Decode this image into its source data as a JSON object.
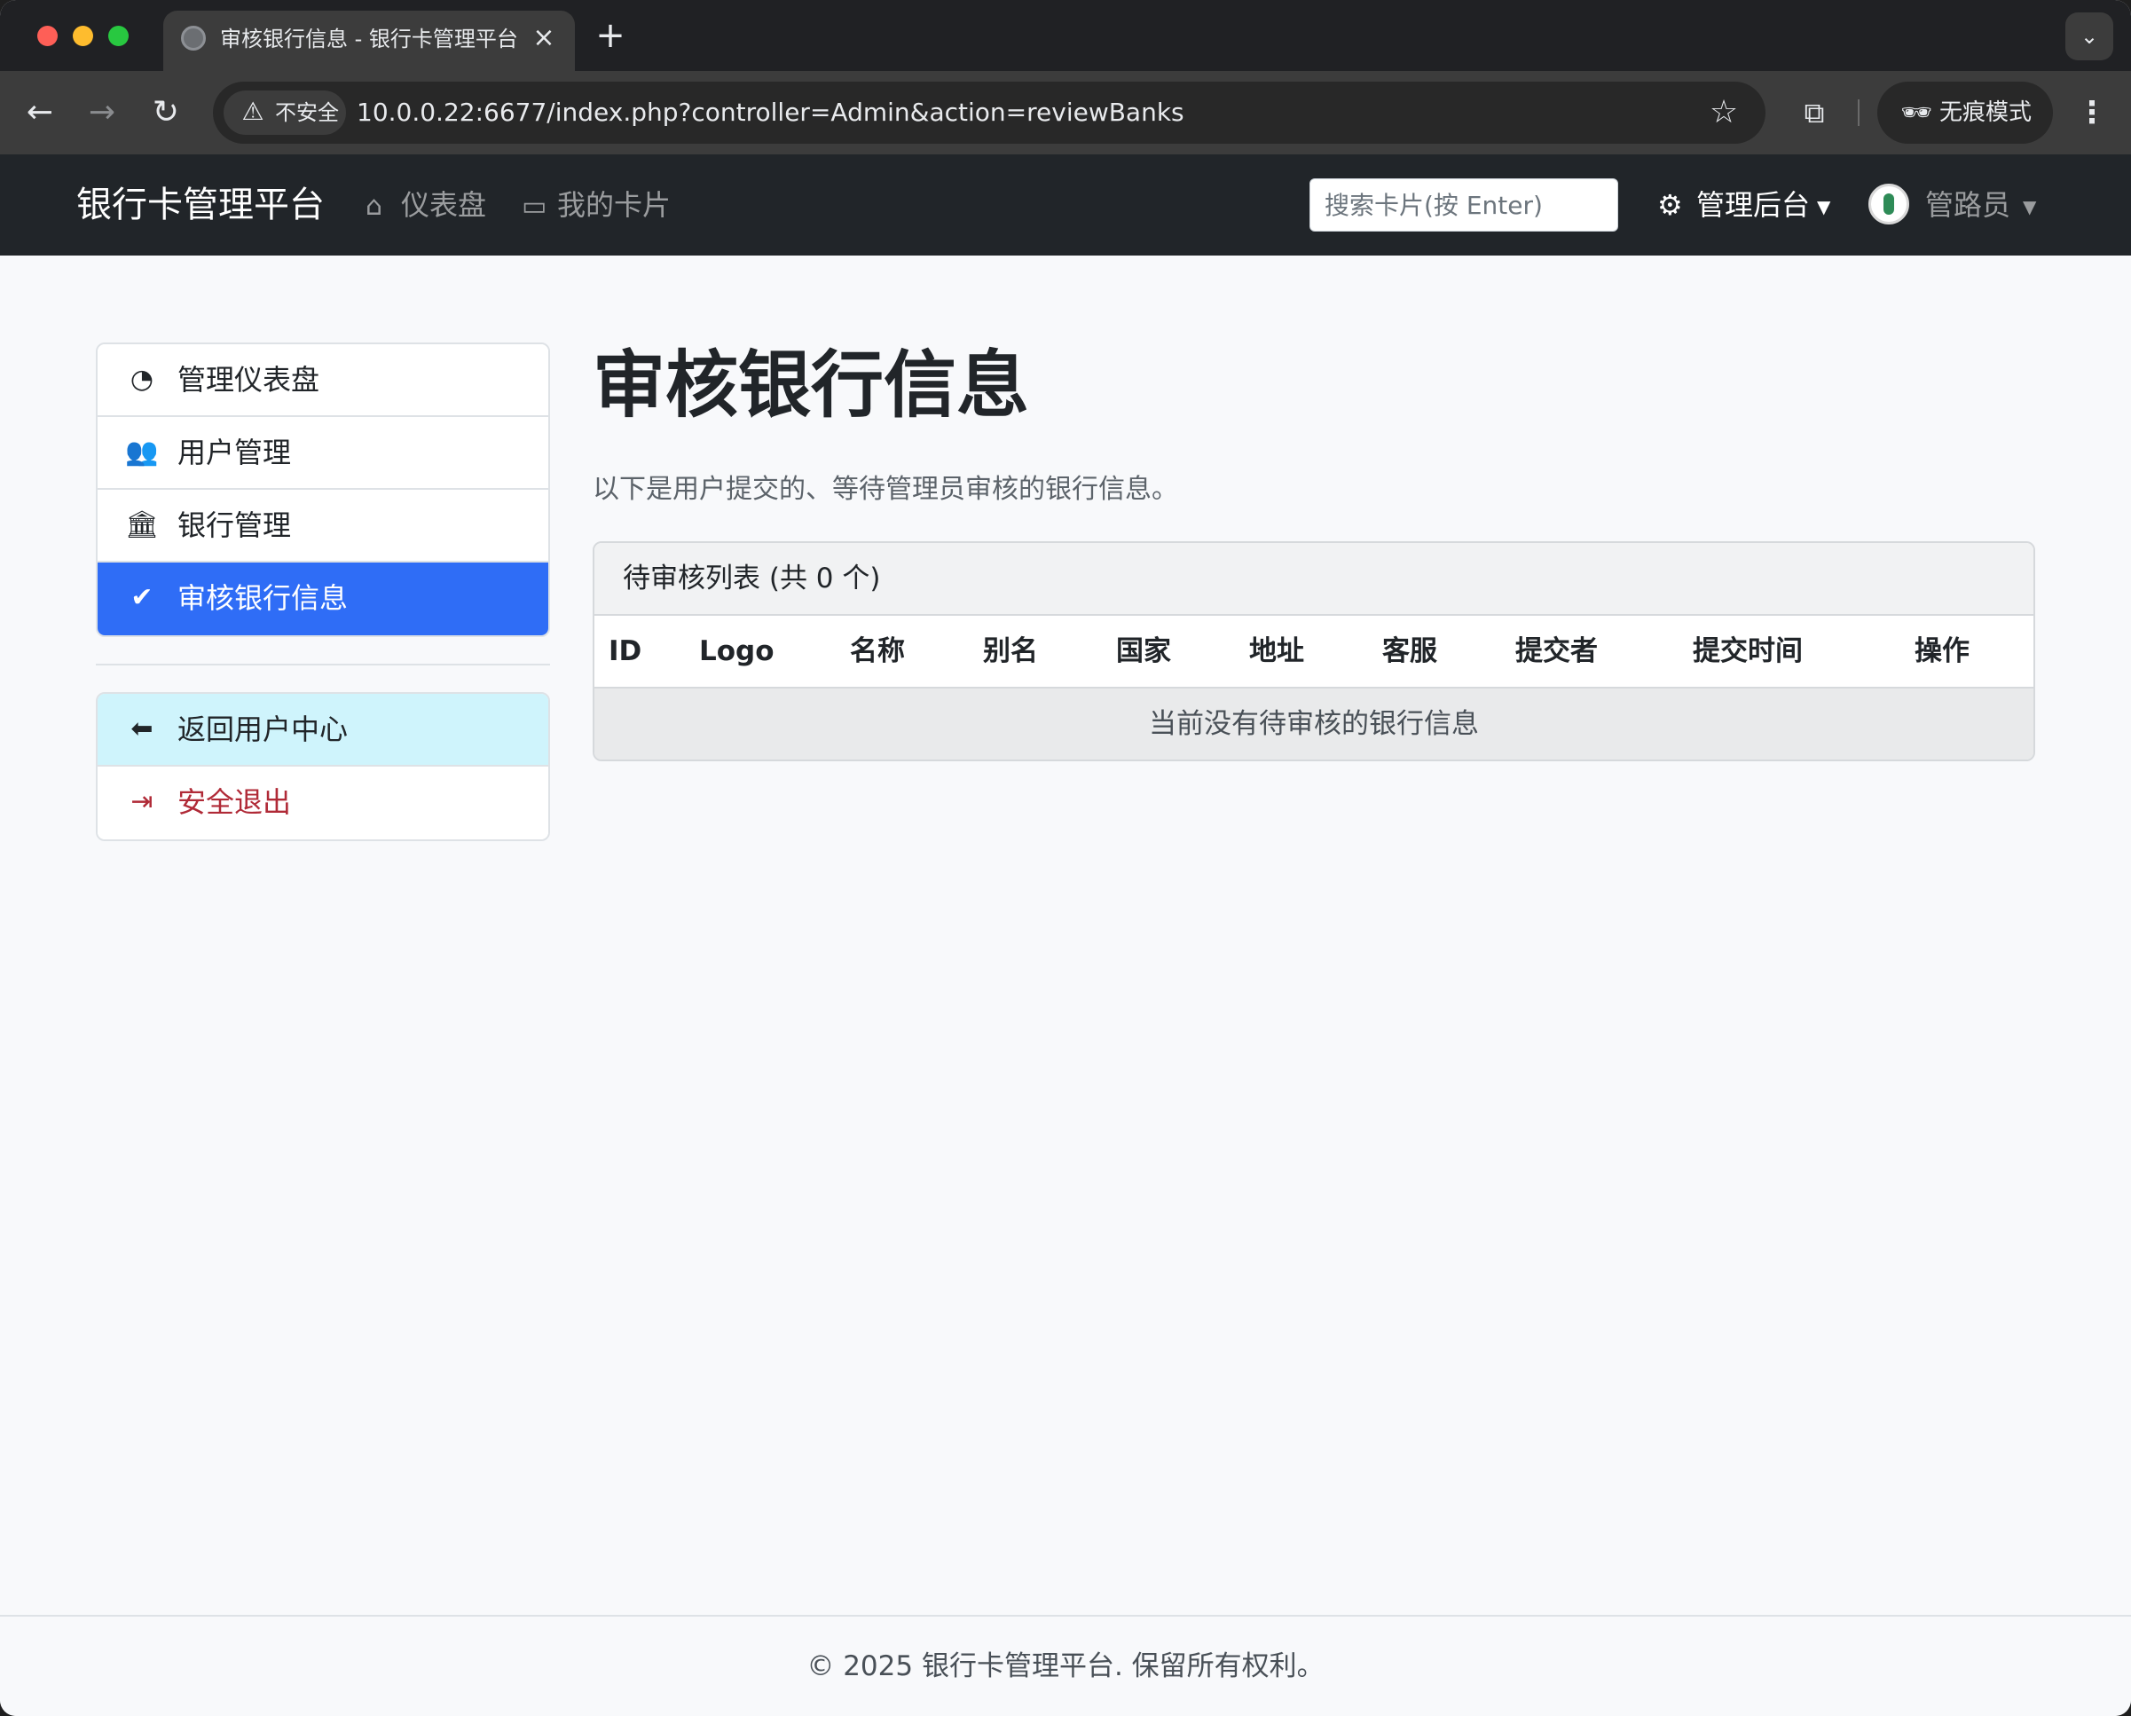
{
  "browser": {
    "tab_title": "审核银行信息 - 银行卡管理平台",
    "security_label": "不安全",
    "url": "10.0.0.22:6677/index.php?controller=Admin&action=reviewBanks",
    "incognito_label": "无痕模式"
  },
  "navbar": {
    "brand": "银行卡管理平台",
    "links": [
      {
        "label": "仪表盘",
        "icon": "house-icon"
      },
      {
        "label": "我的卡片",
        "icon": "credit-card-icon"
      }
    ],
    "search_placeholder": "搜索卡片(按 Enter)",
    "admin_label": "管理后台",
    "user_label": "管路员"
  },
  "sidebar": {
    "items": [
      {
        "label": "管理仪表盘",
        "icon": "speedometer-icon"
      },
      {
        "label": "用户管理",
        "icon": "people-icon"
      },
      {
        "label": "银行管理",
        "icon": "bank-icon"
      },
      {
        "label": "审核银行信息",
        "icon": "patch-check-icon",
        "active": true
      }
    ],
    "bottom_items": [
      {
        "label": "返回用户中心",
        "icon": "arrow-left-circle-icon"
      },
      {
        "label": "安全退出",
        "icon": "box-arrow-right-icon"
      }
    ]
  },
  "main": {
    "title": "审核银行信息",
    "lead": "以下是用户提交的、等待管理员审核的银行信息。",
    "card_header": "待审核列表 (共 0 个)",
    "columns": [
      "ID",
      "Logo",
      "名称",
      "别名",
      "国家",
      "地址",
      "客服",
      "提交者",
      "提交时间",
      "操作"
    ],
    "empty_message": "当前没有待审核的银行信息"
  },
  "footer": {
    "text": "© 2025 银行卡管理平台. 保留所有权利。"
  },
  "colors": {
    "navbar_bg": "#212529",
    "active_item": "#2f6df6",
    "info_item": "#cff4fc",
    "danger_text": "#b02a37"
  }
}
